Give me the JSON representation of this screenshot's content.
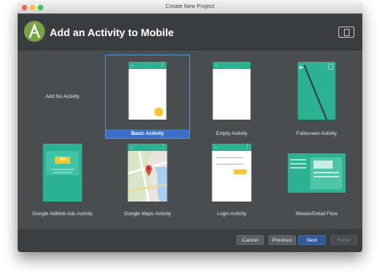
{
  "window": {
    "title": "Create New Project"
  },
  "header": {
    "title": "Add an Activity to Mobile"
  },
  "activities": [
    {
      "label": "Add No Activity"
    },
    {
      "label": "Basic Activity",
      "selected": true
    },
    {
      "label": "Empty Activity"
    },
    {
      "label": "Fullscreen Activity"
    },
    {
      "label": "Google AdMob Ads Activity",
      "ad_text": "Ad"
    },
    {
      "label": "Google Maps Activity"
    },
    {
      "label": "Login Activity"
    },
    {
      "label": "Master/Detail Flow"
    }
  ],
  "footer": {
    "cancel": "Cancel",
    "previous": "Previous",
    "next": "Next",
    "finish": "Finish"
  },
  "colors": {
    "accent": "#2bb293",
    "fab": "#f9c52b",
    "selection": "#3d6fc6"
  }
}
